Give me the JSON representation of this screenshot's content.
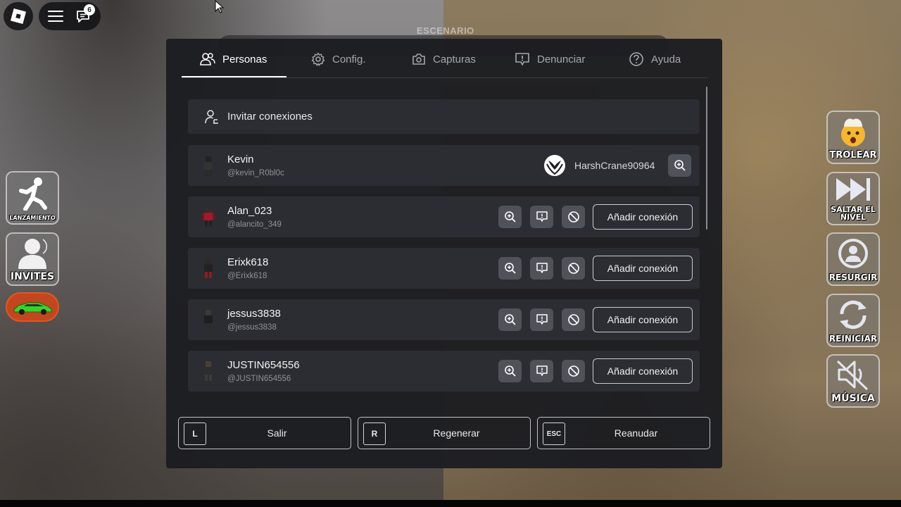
{
  "app": {
    "stage_label": "ESCENARIO",
    "chat_badge": "6"
  },
  "tabs": [
    {
      "label": "Personas",
      "icon": "people-icon",
      "active": true
    },
    {
      "label": "Config.",
      "icon": "gear-icon",
      "active": false
    },
    {
      "label": "Capturas",
      "icon": "camera-icon",
      "active": false
    },
    {
      "label": "Denunciar",
      "icon": "report-icon",
      "active": false
    },
    {
      "label": "Ayuda",
      "icon": "help-icon",
      "active": false
    }
  ],
  "invite": {
    "label": "Invitar conexiones"
  },
  "players": [
    {
      "name": "Kevin",
      "handle": "@kevin_R0bl0c",
      "xbox_gamertag": "HarshCrane90964"
    },
    {
      "name": "Alan_023",
      "handle": "@alancito_349",
      "add_label": "Añadir conexión"
    },
    {
      "name": "Erixk618",
      "handle": "@Erixk618",
      "add_label": "Añadir conexión"
    },
    {
      "name": "jessus3838",
      "handle": "@jessus3838",
      "add_label": "Añadir conexión"
    },
    {
      "name": "JUSTIN654556",
      "handle": "@JUSTIN654556",
      "add_label": "Añadir conexión"
    }
  ],
  "footer": [
    {
      "key": "L",
      "label": "Salir"
    },
    {
      "key": "R",
      "label": "Regenerar"
    },
    {
      "key": "ESC",
      "label": "Reanudar"
    }
  ],
  "left_game_buttons": [
    {
      "label": "LANZAMIENTO",
      "icon": "kick-icon"
    },
    {
      "label": "INVITES",
      "icon": "person-icon"
    },
    {
      "label": "",
      "icon": "car-icon",
      "color": "#c2461f"
    }
  ],
  "right_game_buttons": [
    {
      "label": "TROLEAR",
      "icon": "exploding-head-icon"
    },
    {
      "label": "SALTAR EL NIVEL",
      "icon": "skip-icon"
    },
    {
      "label": "RESURGIR",
      "icon": "respawn-icon"
    },
    {
      "label": "REINICIAR",
      "icon": "restart-icon"
    },
    {
      "label": "MÚSICA",
      "icon": "mute-icon"
    }
  ]
}
